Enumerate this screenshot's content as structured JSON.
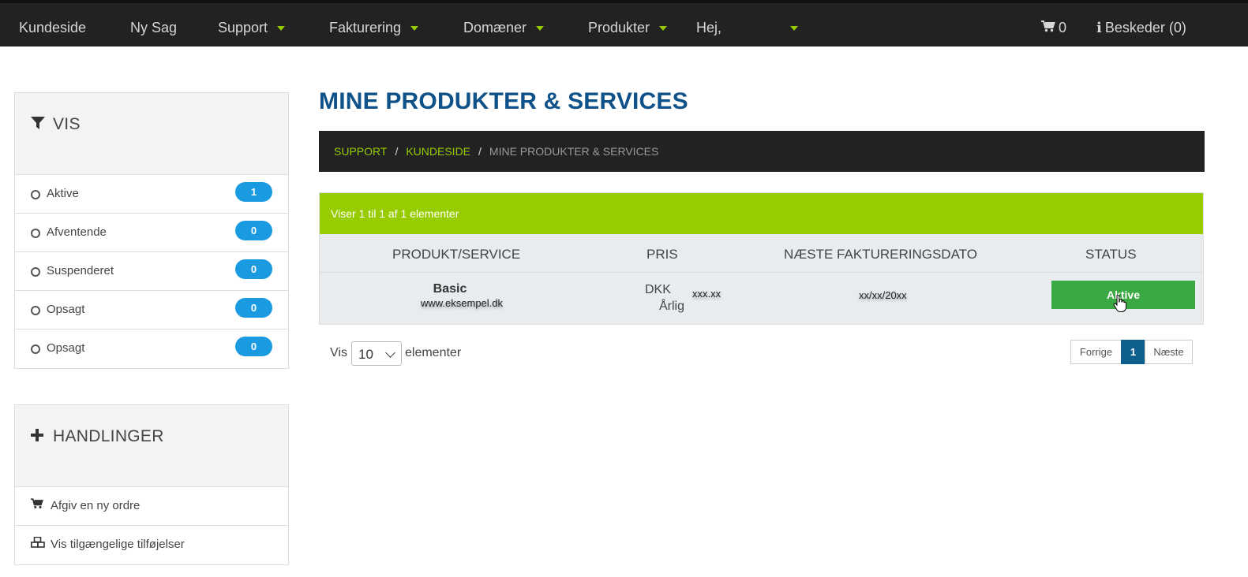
{
  "nav": {
    "items": [
      {
        "label": "Kundeside",
        "dropdown": false
      },
      {
        "label": "Ny Sag",
        "dropdown": false
      },
      {
        "label": "Support",
        "dropdown": true
      },
      {
        "label": "Fakturering",
        "dropdown": true
      },
      {
        "label": "Domæner",
        "dropdown": true
      },
      {
        "label": "Produkter",
        "dropdown": true
      },
      {
        "label": "Hej,",
        "dropdown": true
      }
    ],
    "cart_count": "0",
    "messages_label": "Beskeder (0)",
    "caret_color": "#97cc00"
  },
  "sidebar": {
    "filter_title": "VIS",
    "filters": [
      {
        "label": "Aktive",
        "count": "1"
      },
      {
        "label": "Afventende",
        "count": "0"
      },
      {
        "label": "Suspenderet",
        "count": "0"
      },
      {
        "label": "Opsagt",
        "count": "0"
      },
      {
        "label": "Opsagt",
        "count": "0"
      }
    ],
    "actions_title": "HANDLINGER",
    "actions": [
      {
        "label": "Afgiv en ny ordre",
        "icon": "cart-icon"
      },
      {
        "label": "Vis tilgængelige tilføjelser",
        "icon": "cubes-icon"
      }
    ]
  },
  "main": {
    "title": "MINE PRODUKTER & SERVICES",
    "breadcrumb": {
      "links": [
        "SUPPORT",
        "KUNDESIDE"
      ],
      "current": "MINE PRODUKTER & SERVICES",
      "separator": "/"
    },
    "table": {
      "info": "Viser 1 til 1 af 1 elementer",
      "headers": [
        "PRODUKT/SERVICE",
        "PRIS",
        "NÆSTE FAKTURERINGSDATO",
        "STATUS"
      ],
      "rows": [
        {
          "product": "Basic",
          "domain": "www.eksempel.dk",
          "currency": "DKK",
          "amount": "xxx.xx",
          "cycle": "Årlig",
          "next_due": "xx/xx/20xx",
          "status": "Aktive"
        }
      ]
    },
    "length": {
      "prefix": "Vis",
      "value": "10",
      "suffix": "elementer"
    },
    "pagination": {
      "prev": "Forrige",
      "current": "1",
      "next": "Næste"
    }
  },
  "colors": {
    "accent_green": "#97cc00",
    "title_blue": "#0f5289",
    "status_green": "#3aa843",
    "badge_blue": "#1a9ae0",
    "navbar": "#222222"
  }
}
